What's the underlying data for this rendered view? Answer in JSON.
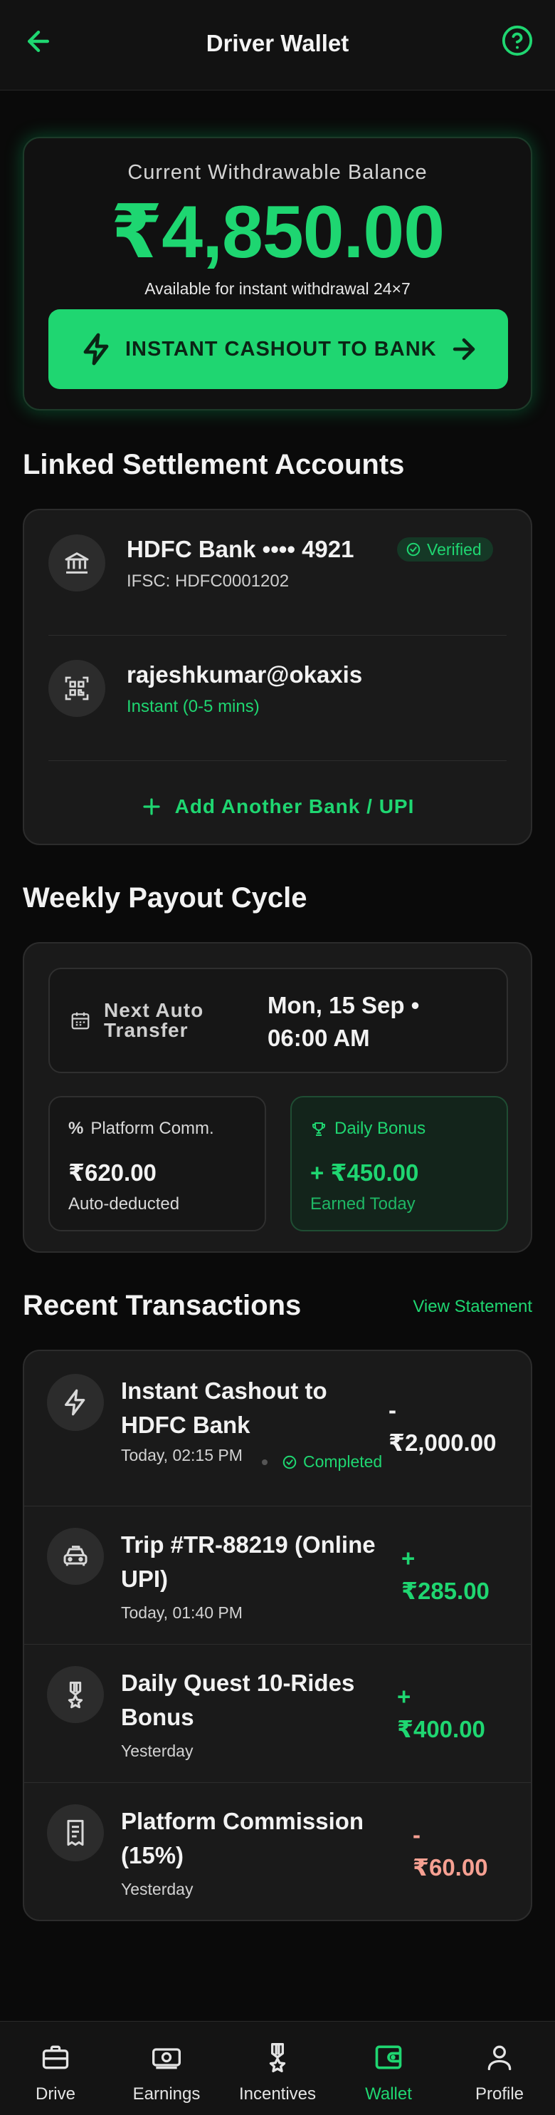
{
  "header": {
    "title": "Driver Wallet",
    "back_icon": "arrow-left-icon",
    "help_icon": "help-circle-icon"
  },
  "balance": {
    "label": "Current Withdrawable Balance",
    "amount": "₹4,850.00",
    "subtitle": "Available for instant withdrawal 24×7",
    "cashout_label": "INSTANT CASHOUT TO BANK"
  },
  "accounts": {
    "title": "Linked Settlement Accounts",
    "items": [
      {
        "name": "HDFC Bank •••• 4921",
        "detail": "IFSC: HDFC0001202",
        "badge": "Verified",
        "icon": "bank-icon"
      },
      {
        "name": "rajeshkumar@okaxis",
        "detail": "Instant (0-5 mins)",
        "icon": "qr-code-icon"
      }
    ],
    "add_label": "Add Another Bank / UPI"
  },
  "payout": {
    "title": "Weekly Payout Cycle",
    "next_label": "Next Auto Transfer",
    "next_value": "Mon, 15 Sep • 06:00 AM",
    "platform": {
      "label": "Platform Comm.",
      "amount": "₹620.00",
      "note": "Auto-deducted"
    },
    "bonus": {
      "label": "Daily Bonus",
      "amount": "+ ₹450.00",
      "note": "Earned Today"
    }
  },
  "transactions": {
    "title": "Recent Transactions",
    "view_label": "View Statement",
    "items": [
      {
        "title": "Instant Cashout to HDFC Bank",
        "meta": "Today, 02:15 PM",
        "status": "Completed",
        "amount_sign": "-",
        "amount": "₹2,000.00",
        "icon": "lightning-icon"
      },
      {
        "title": "Trip #TR-88219 (Online UPI)",
        "meta": "Today, 01:40 PM",
        "amount_sign": "+",
        "amount": "₹285.00",
        "icon": "taxi-icon"
      },
      {
        "title": "Daily Quest 10-Rides Bonus",
        "meta": "Yesterday",
        "amount_sign": "+",
        "amount": "₹400.00",
        "icon": "medal-icon"
      },
      {
        "title": "Platform Commission (15%)",
        "meta": "Yesterday",
        "amount_sign": "-",
        "amount": "₹60.00",
        "icon": "receipt-icon"
      }
    ]
  },
  "nav": {
    "items": [
      {
        "label": "Drive",
        "icon": "briefcase-icon"
      },
      {
        "label": "Earnings",
        "icon": "cash-icon"
      },
      {
        "label": "Incentives",
        "icon": "medal-icon"
      },
      {
        "label": "Wallet",
        "icon": "wallet-icon",
        "active": true
      },
      {
        "label": "Profile",
        "icon": "person-icon"
      }
    ]
  },
  "colors": {
    "accent": "#1fd671",
    "background": "#0a0a0a",
    "card": "#1a1a1a",
    "negative": "#f6a092"
  }
}
